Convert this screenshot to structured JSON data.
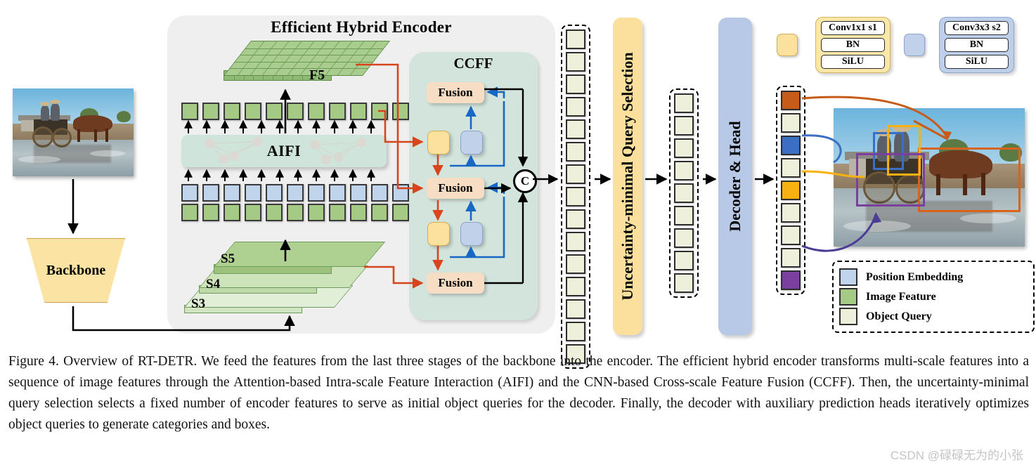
{
  "figure": {
    "caption": "Figure 4. Overview of RT-DETR. We feed the features from the last three stages of the backbone into the encoder. The efficient hybrid encoder transforms multi-scale features into a sequence of image features through the Attention-based Intra-scale Feature Interaction (AIFI) and the CNN-based Cross-scale Feature Fusion (CCFF). Then, the uncertainty-minimal query selection selects a fixed number of encoder features to serve as initial object queries for the decoder. Finally, the decoder with auxiliary prediction heads iteratively optimizes object queries to generate categories and boxes.",
    "watermark": "CSDN @碌碌无为的小张"
  },
  "encoder": {
    "title": "Efficient Hybrid Encoder",
    "aifi_label": "AIFI",
    "f5_label": "F5",
    "stages": [
      {
        "label": "S5"
      },
      {
        "label": "S4"
      },
      {
        "label": "S3"
      }
    ],
    "token_rows": {
      "image_feature_top_count": 11,
      "position_embedding_count": 11,
      "image_feature_bottom_count": 11
    }
  },
  "backbone": {
    "label": "Backbone"
  },
  "ccff": {
    "title": "CCFF",
    "fusion_label": "Fusion",
    "fusion_count": 3,
    "concat_label": "C"
  },
  "query_selection": {
    "label": "Uncertainty-minimal Query Selection"
  },
  "decoder": {
    "label": "Decoder & Head"
  },
  "query_columns": {
    "encoder_features_count": 15,
    "selected_queries_count": 9,
    "decoder_outputs": [
      {
        "color": "#c75b19",
        "highlighted": true
      },
      {
        "color": "#eef0dc",
        "highlighted": false
      },
      {
        "color": "#3b6fc4",
        "highlighted": true
      },
      {
        "color": "#eef0dc",
        "highlighted": false
      },
      {
        "color": "#f7b212",
        "highlighted": true
      },
      {
        "color": "#eef0dc",
        "highlighted": false
      },
      {
        "color": "#eef0dc",
        "highlighted": false
      },
      {
        "color": "#eef0dc",
        "highlighted": false
      },
      {
        "color": "#7b3fa0",
        "highlighted": true
      }
    ]
  },
  "conv_legend": [
    {
      "swatch_color": "#fbe19d",
      "panel_color": "#fbe7a8",
      "rows": [
        "Conv1x1 s1",
        "BN",
        "SiLU"
      ]
    },
    {
      "swatch_color": "#c2d1ea",
      "panel_color": "#bdcfeb",
      "rows": [
        "Conv3x3 s2",
        "BN",
        "SiLU"
      ]
    }
  ],
  "legend": {
    "items": [
      {
        "label": "Position Embedding",
        "color": "#c0d5ec"
      },
      {
        "label": "Image Feature",
        "color": "#a4ca86"
      },
      {
        "label": "Object Query",
        "color": "#eef0dc"
      }
    ]
  },
  "detections": [
    {
      "name": "horse",
      "color": "#d9621d"
    },
    {
      "name": "person-rear",
      "color": "#3b6fc4"
    },
    {
      "name": "person-driver",
      "color": "#f7b212"
    },
    {
      "name": "carriage",
      "color": "#7b3fa0"
    }
  ],
  "colors": {
    "encoder_panel": "#efefef",
    "ccff_panel": "#d3e4dd",
    "aifi": "#cfe5db",
    "fusion": "#f6ddc4",
    "backbone": "#fbe3a4",
    "query_selection": "#fbdf9c",
    "decoder": "#b7c9e6",
    "red_arrow": "#d8441c",
    "blue_arrow": "#1668c4",
    "black_arrow": "#000000"
  }
}
